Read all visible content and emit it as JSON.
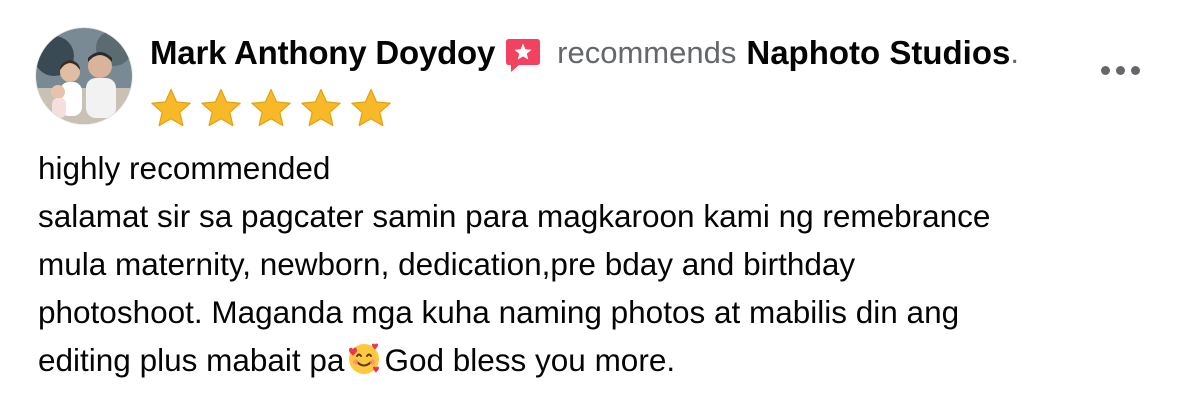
{
  "review": {
    "author_name": "Mark Anthony Doydoy",
    "badge_icon": "recommend-badge-icon",
    "verb": "recommends",
    "page_name": "Naphoto Studios",
    "period": ".",
    "rating": 5,
    "rating_max": 5,
    "star_color": "#f7b928",
    "body_lines": [
      "highly recommended",
      "salamat sir sa pagcater samin para magkaroon kami ng remebrance",
      "mula maternity, newborn, dedication,pre bday and birthday",
      "photoshoot. Maganda mga kuha naming photos at mabilis din ang",
      "editing plus mabait pa",
      "God bless you more."
    ],
    "emoji": "smiling-face-with-hearts"
  },
  "menu": {
    "icon": "more-options-icon"
  },
  "colors": {
    "primary_text": "#050505",
    "secondary_text": "#65676b",
    "badge_color": "#f3425f",
    "background": "#ffffff"
  }
}
